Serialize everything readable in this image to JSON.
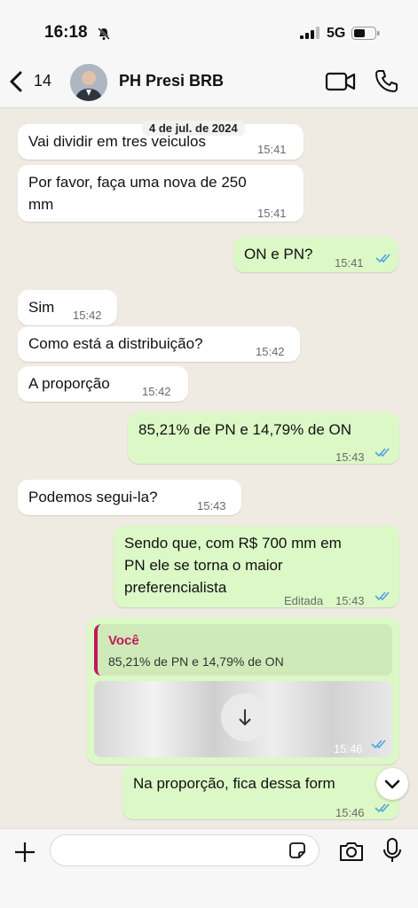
{
  "status": {
    "time": "16:18",
    "network": "5G"
  },
  "header": {
    "back_count": "14",
    "contact_name": "PH Presi BRB"
  },
  "chat": {
    "date_label": "4 de jul. de 2024",
    "messages": [
      {
        "dir": "in",
        "text": "Vai dividir em tres veiculos",
        "time": "15:41"
      },
      {
        "dir": "in",
        "text": "Por favor, faça uma nova de 250\nmm",
        "time": "15:41"
      },
      {
        "dir": "out",
        "text": "ON e PN?",
        "time": "15:41"
      },
      {
        "dir": "in",
        "text": "Sim",
        "time": "15:42"
      },
      {
        "dir": "in",
        "text": "Como está a distribuição?",
        "time": "15:42"
      },
      {
        "dir": "in",
        "text": "A proporção",
        "time": "15:42"
      },
      {
        "dir": "out",
        "text": "85,21% de PN e 14,79% de ON",
        "time": "15:43"
      },
      {
        "dir": "in",
        "text": "Podemos segui-la?",
        "time": "15:43"
      },
      {
        "dir": "out",
        "text": "Sendo que, com R$ 700 mm em\nPN ele se torna o maior\npreferencialista",
        "time": "15:43",
        "edited": "Editada"
      },
      {
        "dir": "out",
        "quote_author": "Você",
        "quote_text": "85,21% de PN e 14,79% de ON",
        "time": "15:46"
      },
      {
        "dir": "out",
        "text": "Na proporção, fica dessa form",
        "time": "15:46"
      }
    ]
  },
  "input": {
    "placeholder": ""
  },
  "colors": {
    "incoming": "#ffffff",
    "outgoing": "#dcf8c6",
    "ticks": "#4fa3e0",
    "quote_accent": "#c2185b"
  }
}
